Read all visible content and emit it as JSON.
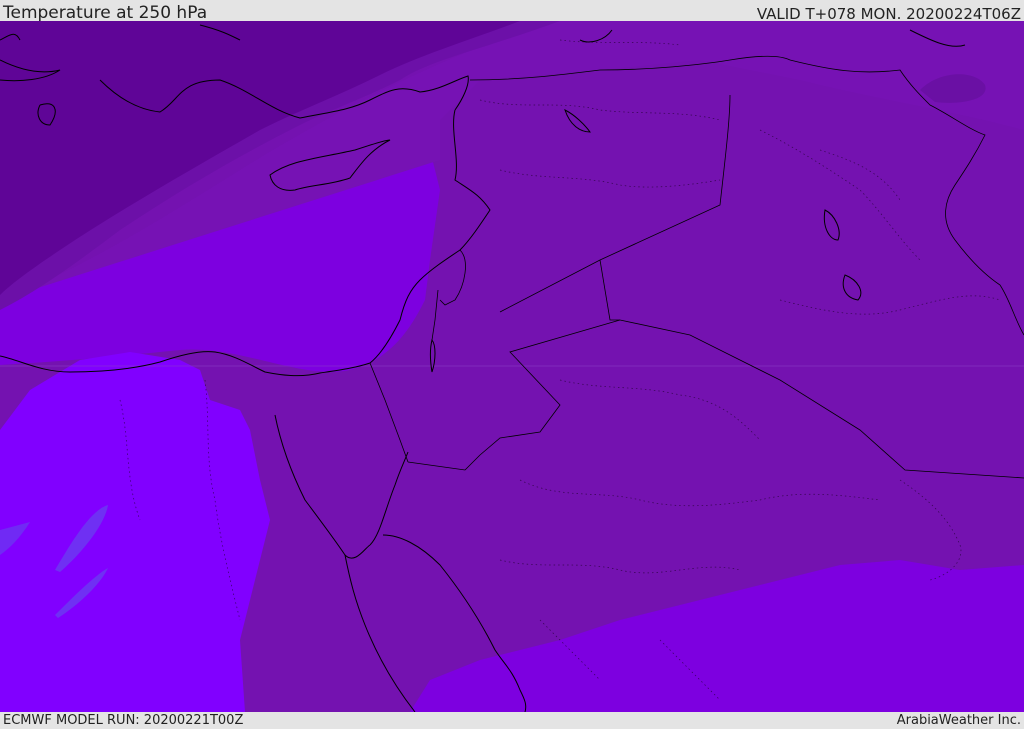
{
  "header": {
    "title": "Temperature at 250 hPa",
    "valid": "VALID T+078 MON. 20200224T06Z"
  },
  "footer": {
    "model_run": "ECMWF MODEL RUN: 20200221T00Z",
    "credit": "ArabiaWeather Inc."
  },
  "map": {
    "field": "temperature-250hPa",
    "colors": {
      "coldest_band": "#5f0597",
      "cold_band": "#6c10a8",
      "mid_band": "#7612b4",
      "land_band": "#7412b0",
      "warm_band": "#7d00e0",
      "warmer_band": "#8100ff",
      "warmest_band": "#6a3cf0",
      "coastline": "#000000"
    }
  }
}
